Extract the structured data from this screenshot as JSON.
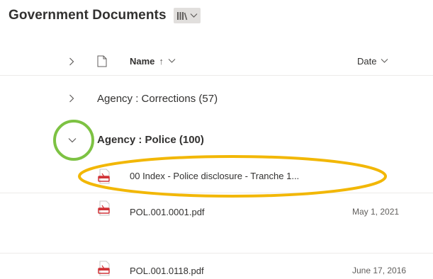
{
  "page": {
    "title": "Government Documents"
  },
  "header": {
    "name_label": "Name",
    "name_sort_arrow": "↑",
    "date_label": "Date"
  },
  "groups": [
    {
      "label": "Agency : Corrections (57)",
      "expanded": false
    },
    {
      "label": "Agency : Police (100)",
      "expanded": true
    }
  ],
  "files": [
    {
      "name": "00 Index - Police disclosure - Tranche 1...",
      "date": ""
    },
    {
      "name": "POL.001.0001.pdf",
      "date": "May 1, 2021"
    },
    {
      "name": "POL.001.0118.pdf",
      "date": "June 17, 2016"
    }
  ],
  "colors": {
    "accent_pdf": "#d13438",
    "annotation_circle": "#7dc243",
    "annotation_ellipse": "#f2b705",
    "view_switch_bg": "#e1dfdd"
  },
  "icons": {
    "view": "library-icon",
    "pdf": "pdf-file-icon",
    "file": "document-icon"
  }
}
